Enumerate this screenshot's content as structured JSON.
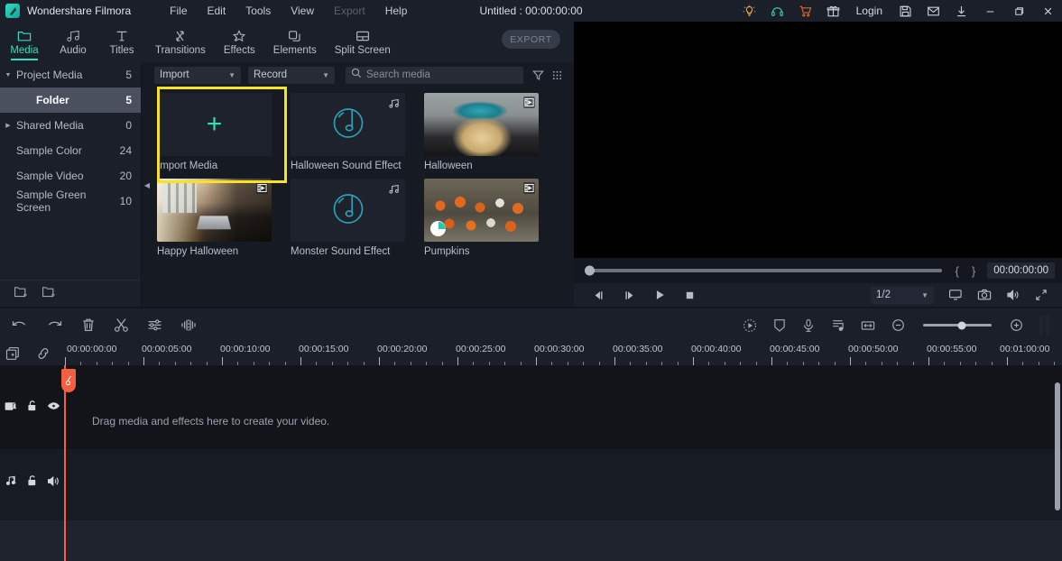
{
  "titlebar": {
    "app_name": "Wondershare Filmora",
    "logo_icon": "filmora-logo-icon",
    "menus": [
      {
        "label": "File",
        "disabled": false
      },
      {
        "label": "Edit",
        "disabled": false
      },
      {
        "label": "Tools",
        "disabled": false
      },
      {
        "label": "View",
        "disabled": false
      },
      {
        "label": "Export",
        "disabled": true
      },
      {
        "label": "Help",
        "disabled": false
      }
    ],
    "document_title": "Untitled : 00:00:00:00",
    "right_icons": [
      {
        "name": "lightbulb-icon",
        "color": "#e8a33d"
      },
      {
        "name": "headphone-support-icon",
        "color": "#2ec4ae"
      },
      {
        "name": "shopping-cart-icon",
        "color": "#e2691f"
      },
      {
        "name": "gift-icon",
        "color": "#c9ced8"
      }
    ],
    "login_label": "Login",
    "right_icons2": [
      {
        "name": "save-icon",
        "color": "#c9ced8"
      },
      {
        "name": "mail-icon",
        "color": "#c9ced8"
      },
      {
        "name": "download-icon",
        "color": "#c9ced8"
      }
    ],
    "window_buttons": [
      {
        "name": "minimize-button",
        "glyph": "—"
      },
      {
        "name": "maximize-button",
        "glyph": "❐"
      },
      {
        "name": "close-button",
        "glyph": "✕"
      }
    ]
  },
  "navtabs": [
    {
      "label": "Media",
      "icon": "folder-icon",
      "active": true
    },
    {
      "label": "Audio",
      "icon": "music-note-icon",
      "active": false
    },
    {
      "label": "Titles",
      "icon": "text-t-icon",
      "active": false
    },
    {
      "label": "Transitions",
      "icon": "transition-arrows-icon",
      "active": false
    },
    {
      "label": "Effects",
      "icon": "star-sparkle-icon",
      "active": false
    },
    {
      "label": "Elements",
      "icon": "layers-icon",
      "active": false
    },
    {
      "label": "Split Screen",
      "icon": "split-screen-icon",
      "active": false
    }
  ],
  "export_button": {
    "label": "EXPORT",
    "enabled": false
  },
  "sidebar": {
    "items": [
      {
        "label": "Project Media",
        "count": "5",
        "arrow": "down",
        "selected": false,
        "indent": false
      },
      {
        "label": "Folder",
        "count": "5",
        "arrow": "",
        "selected": true,
        "indent": true
      },
      {
        "label": "Shared Media",
        "count": "0",
        "arrow": "right",
        "selected": false,
        "indent": false
      },
      {
        "label": "Sample Color",
        "count": "24",
        "arrow": "",
        "selected": false,
        "indent": false
      },
      {
        "label": "Sample Video",
        "count": "20",
        "arrow": "",
        "selected": false,
        "indent": false
      },
      {
        "label": "Sample Green Screen",
        "count": "10",
        "arrow": "",
        "selected": false,
        "indent": false
      }
    ],
    "footer_icons": [
      {
        "name": "new-folder-icon"
      },
      {
        "name": "remove-folder-icon"
      }
    ],
    "collapse_icon": "collapse-left-icon"
  },
  "media_toolbar": {
    "import_label": "Import",
    "record_label": "Record",
    "search_placeholder": "Search media",
    "search_value": "",
    "filter_icon": "filter-funnel-icon",
    "grid_icon": "grid-view-icon",
    "search_icon": "search-icon"
  },
  "media_items": [
    {
      "label": "Import Media",
      "kind": "import",
      "badge": "",
      "highlighted": true
    },
    {
      "label": "Halloween Sound Effect",
      "kind": "audio",
      "badge": "music-note-badge",
      "highlighted": false
    },
    {
      "label": "Halloween",
      "kind": "photo-halloween",
      "badge": "film-strip-badge",
      "highlighted": false
    },
    {
      "label": "Happy Halloween",
      "kind": "photo-office",
      "badge": "film-strip-badge",
      "highlighted": false
    },
    {
      "label": "Monster Sound Effect",
      "kind": "audio",
      "badge": "music-note-badge",
      "highlighted": false
    },
    {
      "label": "Pumpkins",
      "kind": "photo-pumpkins",
      "badge": "film-strip-badge",
      "highlighted": false
    }
  ],
  "player": {
    "seek_position_percent": 0,
    "mark_in_label": "{",
    "mark_out_label": "}",
    "timecode": "00:00:00:00",
    "controls": [
      {
        "name": "previous-frame-button",
        "icon": "prev-frame-icon"
      },
      {
        "name": "next-frame-button",
        "icon": "next-frame-icon"
      },
      {
        "name": "play-button",
        "icon": "play-icon"
      },
      {
        "name": "stop-button",
        "icon": "stop-icon"
      }
    ],
    "quality_label": "1/2",
    "right_controls": [
      {
        "name": "render-preview-button",
        "icon": "monitor-icon"
      },
      {
        "name": "snapshot-button",
        "icon": "camera-icon"
      },
      {
        "name": "volume-button",
        "icon": "speaker-icon"
      },
      {
        "name": "fullscreen-button",
        "icon": "expand-arrows-icon"
      }
    ]
  },
  "timeline_toolbar": {
    "left_icons": [
      {
        "name": "undo-icon"
      },
      {
        "name": "redo-icon"
      },
      {
        "name": "delete-icon"
      },
      {
        "name": "split-scissors-icon"
      },
      {
        "name": "adjust-sliders-icon"
      },
      {
        "name": "audio-waveform-icon"
      }
    ],
    "right_icons": [
      {
        "name": "record-voiceover-icon"
      },
      {
        "name": "crop-shield-icon"
      },
      {
        "name": "microphone-icon"
      },
      {
        "name": "markers-icon"
      },
      {
        "name": "fit-timeline-icon"
      }
    ],
    "zoom_out_icon": "zoom-out-icon",
    "zoom_in_icon": "zoom-in-icon",
    "zoom_slider_percent": 56,
    "pause_bars_icon": "pause-bars-icon"
  },
  "timeline_corner_icons": [
    {
      "name": "add-track-icon"
    },
    {
      "name": "link-clips-icon"
    }
  ],
  "ruler": {
    "labels": [
      "00:00:00:00",
      "00:00:05:00",
      "00:00:10:00",
      "00:00:15:00",
      "00:00:20:00",
      "00:00:25:00",
      "00:00:30:00",
      "00:00:35:00",
      "00:00:40:00",
      "00:00:45:00",
      "00:00:50:00",
      "00:00:55:00",
      "00:01:00:00"
    ]
  },
  "tracks": [
    {
      "type": "video",
      "number": "1",
      "track_icon": "video-track-icon",
      "lock_icon": "unlock-icon",
      "visibility_icon": "eye-icon"
    },
    {
      "type": "audio",
      "number": "1",
      "track_icon": "audio-track-icon",
      "lock_icon": "unlock-icon",
      "visibility_icon": "speaker-icon"
    }
  ],
  "drop_hint": "Drag media and effects here to create your video.",
  "playhead": {
    "position_label": "",
    "color": "#f2603f"
  },
  "colors": {
    "accent_teal": "#2ee0bd",
    "highlight_yellow": "#f7e223",
    "playhead_red": "#f2603f",
    "panel_bg": "#1b1f2a",
    "deep_bg": "#14171f"
  }
}
